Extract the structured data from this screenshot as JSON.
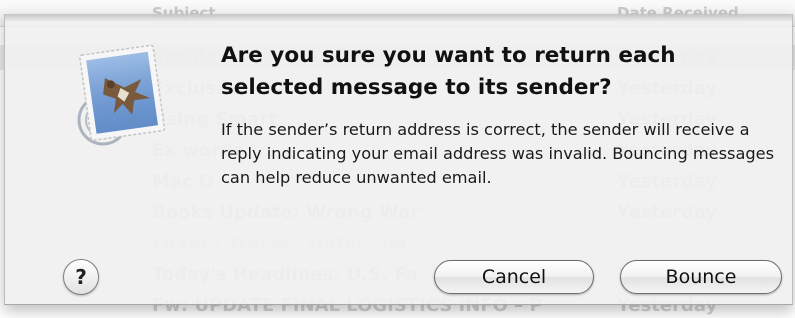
{
  "background_list": {
    "header": {
      "subject_col": "Subject",
      "date_col": "Date Received"
    },
    "rows": [
      {
        "subject": "Staple",
        "date": "Yesterday",
        "style": "sel"
      },
      {
        "subject": "Exclusive",
        "date": "Yesterday",
        "style": ""
      },
      {
        "subject": "Using Smart",
        "date": "Yesterday",
        "style": ""
      },
      {
        "subject": "Ex words",
        "date": "Yesterday",
        "style": ""
      },
      {
        "subject": "Mac O",
        "date": "Yesterday",
        "style": ""
      },
      {
        "subject": "Books Update: Wrong War\"",
        "date": "Yesterday",
        "style": ""
      },
      {
        "subject": "Luxury Travel | Hotel Spa",
        "date": "",
        "style": "faint"
      },
      {
        "subject": "Today's Headlines: U.S. Fa",
        "date": "Yesterday",
        "style": ""
      },
      {
        "subject": "Fw: UPDATE FINAL LOGISTICS INFO – P",
        "date": "Yesterday",
        "style": ""
      }
    ]
  },
  "alert": {
    "title": "Are you sure you want to return each selected message to its sender?",
    "message": "If the sender’s return address is correct, the sender will receive a reply indicating your email address was invalid. Bouncing messages can help reduce unwanted email.",
    "help_label": "?",
    "cancel_label": "Cancel",
    "confirm_label": "Bounce",
    "icon": "mail-hawk-stamp-icon"
  }
}
